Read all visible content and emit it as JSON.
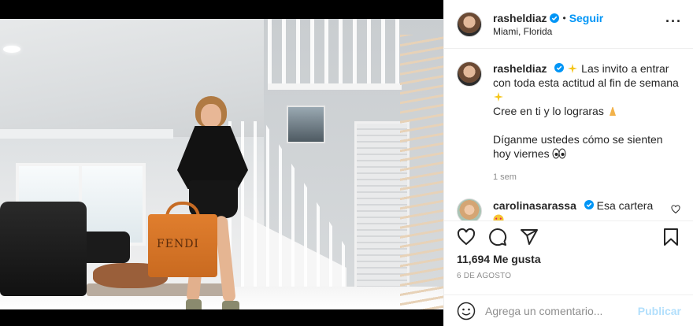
{
  "post": {
    "username": "rasheldiaz",
    "follow_label": "Seguir",
    "dot": "•",
    "location": "Miami, Florida",
    "more_label": "···",
    "bag_brand": "FENDI",
    "caption": {
      "line1": "Las invito a entrar con toda esta actitud al fin de semana",
      "line2": "Cree en ti y lo lograras",
      "line3": "Díganme ustedes cómo se sienten hoy viernes",
      "time": "1 sem"
    },
    "comment": {
      "username": "carolinasarassa",
      "text": "Esa cartera"
    },
    "likes": "11,694 Me gusta",
    "date": "6 DE AGOSTO",
    "add_comment_placeholder": "Agrega un comentario...",
    "publish_label": "Publicar"
  },
  "colors": {
    "accent": "#0095f6",
    "muted": "#8e8e8e",
    "publish_disabled": "#b2dffc"
  },
  "icons": [
    "verified-badge-icon",
    "more-icon",
    "heart-icon",
    "comment-icon",
    "share-icon",
    "bookmark-icon",
    "emoji-icon",
    "sparkles-emoji-icon",
    "pray-emoji-icon",
    "eyes-emoji-icon",
    "heart-eyes-emoji-icon"
  ]
}
